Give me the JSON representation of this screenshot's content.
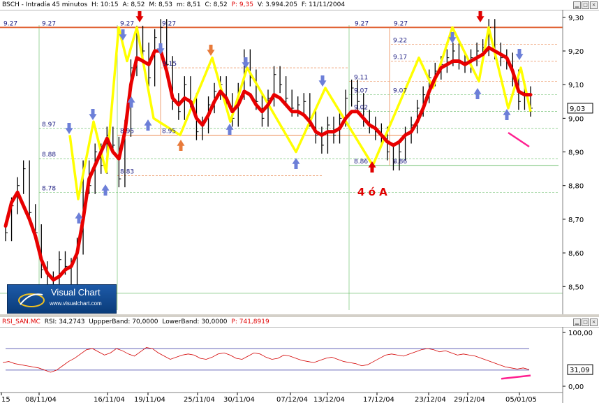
{
  "price_header": {
    "symbol": "BSCH - Intradía 45 minutos",
    "h": "H: 10:15",
    "a": "A: 8,52",
    "m": "M: 8,53",
    "min": "m: 8,51",
    "c": "C: 8,52",
    "p": "P: 9,35",
    "v": "V: 3.994.205",
    "f": "F: 11/11/2004"
  },
  "rsi_header": {
    "name": "RSI_SAN.MC",
    "rsi": "RSI: 34,2743",
    "upper": "UppperBand: 70,0000",
    "lower": "LowerBand: 30,0000",
    "p": "P: 741,8919"
  },
  "logo": {
    "title": "Visual Chart",
    "url": "www.visualchart.com"
  },
  "colors": {
    "ma": "#e80000",
    "zigzag": "#ffff00",
    "arrow_blue": "#6c7fd8",
    "arrow_red": "#e00000",
    "arrow_orange": "#e87a3a",
    "grid_green": "#5cb85c",
    "level_orange": "#e87a3a",
    "rsi": "#d40000",
    "band": "#3030a0",
    "pink": "#ff2090"
  },
  "chart_data": [
    {
      "type": "line",
      "title": "BSCH - Intradía 45 minutos",
      "ylim": [
        8.43,
        9.31
      ],
      "y_ticks": [
        {
          "v": 8.5,
          "label": "8,50"
        },
        {
          "v": 8.6,
          "label": "8,60"
        },
        {
          "v": 8.7,
          "label": "8,70"
        },
        {
          "v": 8.8,
          "label": "8,80"
        },
        {
          "v": 8.9,
          "label": "8,90"
        },
        {
          "v": 9.0,
          "label": "9,00"
        },
        {
          "v": 9.1,
          "label": "9,10"
        },
        {
          "v": 9.2,
          "label": "9,20"
        },
        {
          "v": 9.3,
          "label": "9,30"
        }
      ],
      "last_value": "9,03",
      "x_labels": [
        "15",
        "08/11/04",
        "16/11/04",
        "19/11/04",
        "25/11/04",
        "30/11/04",
        "07/12/04",
        "13/12/04",
        "17/12/04",
        "23/12/04",
        "29/12/04",
        "05/01/05"
      ],
      "levels": [
        {
          "v": 9.27,
          "label": "9.27"
        },
        {
          "v": 9.22,
          "label": "9.22"
        },
        {
          "v": 9.17,
          "label": "9.17"
        },
        {
          "v": 9.15,
          "label": "9.15"
        },
        {
          "v": 9.11,
          "label": "9.11"
        },
        {
          "v": 9.07,
          "label": "9.07"
        },
        {
          "v": 9.02,
          "label": "9.02"
        },
        {
          "v": 8.97,
          "label": "8.97"
        },
        {
          "v": 8.95,
          "label": "8.95"
        },
        {
          "v": 8.88,
          "label": "8.88"
        },
        {
          "v": 8.86,
          "label": "8.86"
        },
        {
          "v": 8.83,
          "label": "8.83"
        },
        {
          "v": 8.78,
          "label": "8.78"
        }
      ],
      "annotation": "4 ó A",
      "series": [
        {
          "name": "",
          "style": "bars",
          "values": [
            8.66,
            8.74,
            8.8,
            8.85,
            8.72,
            8.66,
            8.55,
            8.48,
            8.52,
            8.58,
            8.56,
            8.5,
            8.62,
            8.85,
            8.8,
            8.9,
            8.86,
            8.95,
            8.92,
            8.82,
            8.97,
            9.15,
            9.25,
            9.2,
            9.12,
            9.24,
            9.27,
            9.16,
            9.05,
            9.02,
            9.1,
            9.05,
            8.96,
            8.98,
            9.04,
            9.08,
            9.1,
            9.05,
            9.0,
            9.08,
            9.18,
            9.12,
            9.05,
            9.0,
            9.06,
            9.13,
            9.1,
            9.06,
            9.03,
            9.04,
            9.05,
            9.0,
            8.95,
            8.92,
            8.98,
            8.95,
            9.0,
            9.06,
            9.09,
            9.05,
            9.0,
            8.98,
            8.96,
            8.95,
            8.9,
            8.87,
            8.9,
            8.95,
            8.98,
            9.03,
            9.07,
            9.12,
            9.14,
            9.16,
            9.18,
            9.2,
            9.17,
            9.16,
            9.18,
            9.2,
            9.21,
            9.27,
            9.2,
            9.18,
            9.17,
            9.12,
            9.05,
            9.07,
            9.03
          ]
        },
        {
          "name": "",
          "style": "ma",
          "values": [
            8.68,
            8.75,
            8.78,
            8.74,
            8.7,
            8.65,
            8.58,
            8.54,
            8.52,
            8.53,
            8.55,
            8.56,
            8.6,
            8.7,
            8.82,
            8.86,
            8.9,
            8.94,
            8.9,
            8.88,
            8.96,
            9.1,
            9.18,
            9.17,
            9.16,
            9.2,
            9.2,
            9.14,
            9.06,
            9.04,
            9.06,
            9.05,
            9.0,
            8.98,
            9.01,
            9.05,
            9.08,
            9.06,
            9.02,
            9.04,
            9.08,
            9.07,
            9.04,
            9.02,
            9.04,
            9.07,
            9.06,
            9.04,
            9.02,
            9.02,
            9.01,
            8.99,
            8.96,
            8.95,
            8.96,
            8.96,
            8.97,
            9.0,
            9.02,
            9.02,
            9.0,
            8.98,
            8.97,
            8.95,
            8.93,
            8.92,
            8.93,
            8.95,
            8.96,
            8.99,
            9.03,
            9.08,
            9.12,
            9.15,
            9.16,
            9.17,
            9.17,
            9.16,
            9.17,
            9.18,
            9.19,
            9.21,
            9.2,
            9.19,
            9.18,
            9.14,
            9.08,
            9.07,
            9.07
          ]
        },
        {
          "name": "",
          "style": "zigzag",
          "values": [
            8.95,
            8.76,
            8.99,
            8.84,
            9.27,
            9.17,
            9.27,
            9.0,
            8.95,
            9.18,
            8.99,
            9.15,
            8.9,
            9.09,
            8.86,
            9.18,
            9.09,
            9.27,
            9.11,
            9.27,
            9.03,
            9.15,
            9.02
          ]
        }
      ]
    },
    {
      "type": "line",
      "title": "RSI_SAN.MC",
      "ylim": [
        0,
        100
      ],
      "y_ticks": [
        {
          "v": 0,
          "label": "0,00"
        },
        {
          "v": 100,
          "label": "100,00"
        }
      ],
      "bands": [
        70,
        30
      ],
      "last_value": "31,09",
      "series": [
        {
          "name": "RSI",
          "values": [
            44,
            46,
            42,
            40,
            38,
            36,
            34,
            30,
            26,
            30,
            38,
            46,
            52,
            60,
            68,
            70,
            64,
            58,
            62,
            70,
            66,
            60,
            56,
            64,
            72,
            70,
            62,
            56,
            50,
            54,
            58,
            60,
            58,
            52,
            50,
            54,
            60,
            62,
            58,
            52,
            50,
            56,
            62,
            60,
            54,
            50,
            52,
            58,
            56,
            52,
            48,
            46,
            44,
            48,
            52,
            54,
            50,
            46,
            44,
            42,
            38,
            40,
            46,
            52,
            58,
            60,
            58,
            56,
            60,
            64,
            68,
            70,
            68,
            64,
            66,
            62,
            58,
            60,
            58,
            56,
            52,
            48,
            44,
            40,
            36,
            34,
            32,
            34,
            31
          ]
        }
      ]
    }
  ]
}
